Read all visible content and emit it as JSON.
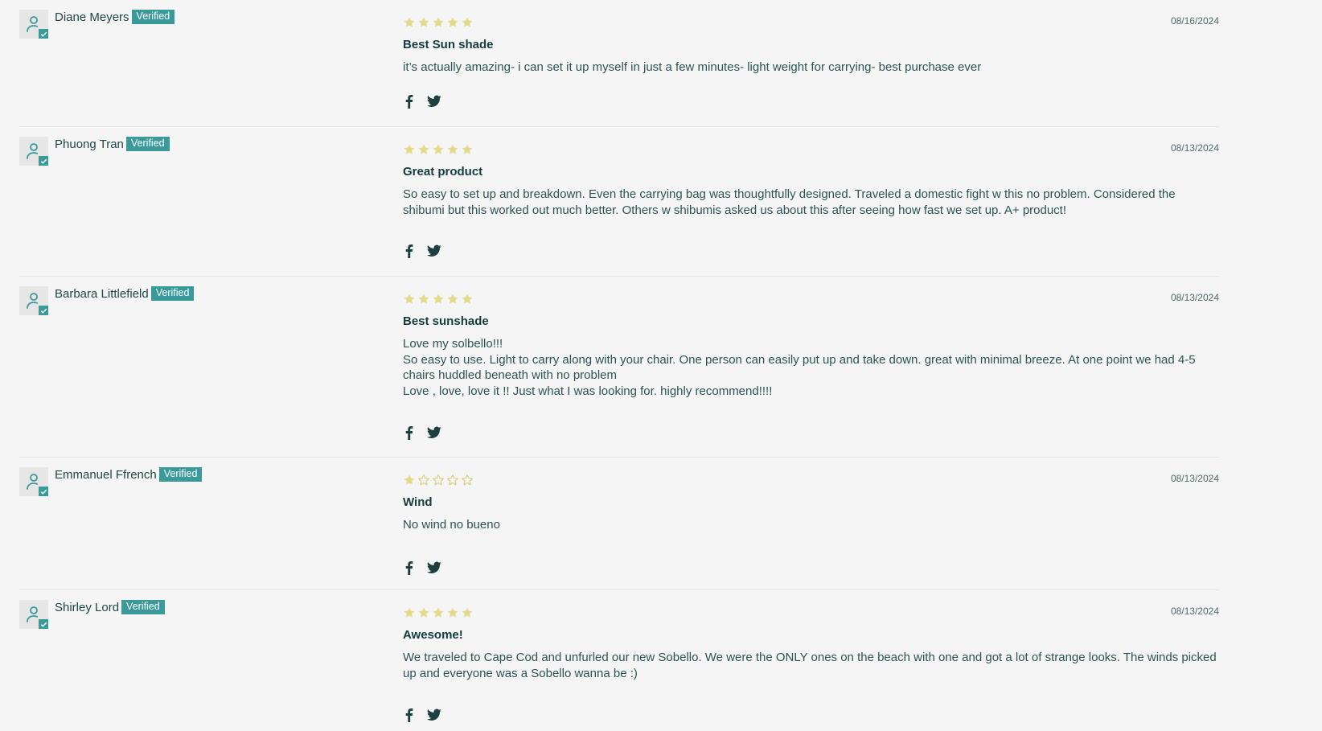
{
  "reviews": [
    {
      "name": "Diane Meyers",
      "badge": "Verified",
      "date": "08/16/2024",
      "rating": 5,
      "title": "Best Sun shade",
      "body": [
        "it’s actually amazing- i can set it up myself in just a few minutes- light weight for carrying- best purchase ever"
      ]
    },
    {
      "name": "Phuong Tran",
      "badge": "Verified",
      "date": "08/13/2024",
      "rating": 5,
      "title": "Great product",
      "body": [
        "So easy to set up and breakdown. Even the carrying bag was thoughtfully designed. Traveled a domestic fight w this no problem. Considered the shibumi but this worked out much better. Others w shibumis asked us about this after seeing how fast we set up. A+ product!"
      ]
    },
    {
      "name": "Barbara Littlefield",
      "badge": "Verified",
      "date": "08/13/2024",
      "rating": 5,
      "title": "Best sunshade",
      "body": [
        "Love my solbello!!!",
        "So easy to use. Light to carry along with your chair. One person can easily put up and take down. great with minimal breeze. At one point we had 4-5 chairs huddled beneath with no problem",
        "Love , love, love it !! Just what I was looking for. highly recommend!!!!"
      ]
    },
    {
      "name": "Emmanuel Ffrench",
      "badge": "Verified",
      "date": "08/13/2024",
      "rating": 1,
      "title": "Wind",
      "body": [
        "No wind no bueno"
      ]
    },
    {
      "name": "Shirley Lord",
      "badge": "Verified",
      "date": "08/13/2024",
      "rating": 5,
      "title": "Awesome!",
      "body": [
        "We traveled to Cape Cod and unfurled our new Sobello. We were the ONLY ones on the beach with one and got a lot of strange looks. The winds picked up and everyone was a Sobello wanna be :)"
      ]
    }
  ],
  "colors": {
    "accent": "#3a9a9a",
    "star_filled": "#e3d98a",
    "star_outline": "#d9cf7e",
    "text": "#1f4747"
  },
  "icons": {
    "avatar": "user-icon",
    "verified": "check-icon",
    "star_full": "star-filled-icon",
    "star_empty": "star-outline-icon",
    "share_1": "facebook-icon",
    "share_2": "twitter-icon"
  }
}
